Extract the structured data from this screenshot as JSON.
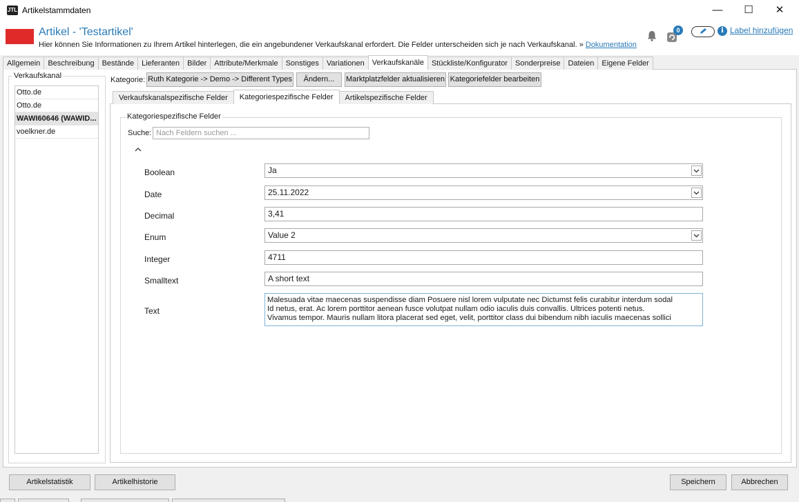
{
  "window": {
    "title": "Artikelstammdaten",
    "logo_text": "JTL",
    "minimize": "—",
    "maximize": "☐",
    "close": "✕"
  },
  "header": {
    "title": "Artikel - 'Testartikel'",
    "description": "Hier können Sie Informationen zu Ihrem Artikel hinterlegen, die ein angebundener Verkaufskanal erfordert. Die Felder unterscheiden sich je nach Verkaufskanal.",
    "arrow": "»",
    "doc_link": "Dokumentation",
    "refresh_badge": "0",
    "info_glyph": "i",
    "label_link": "Label hinzufügen"
  },
  "main_tabs": [
    {
      "label": "Allgemein"
    },
    {
      "label": "Beschreibung"
    },
    {
      "label": "Bestände"
    },
    {
      "label": "Lieferanten"
    },
    {
      "label": "Bilder"
    },
    {
      "label": "Attribute/Merkmale"
    },
    {
      "label": "Sonstiges"
    },
    {
      "label": "Variationen"
    },
    {
      "label": "Verkaufskanäle",
      "active": true
    },
    {
      "label": "Stückliste/Konfigurator"
    },
    {
      "label": "Sonderpreise"
    },
    {
      "label": "Dateien"
    },
    {
      "label": "Eigene Felder"
    }
  ],
  "channels": {
    "title": "Verkaufskanal",
    "items": [
      {
        "label": "Otto.de"
      },
      {
        "label": "Otto.de"
      },
      {
        "label": "WAWI60646 (WAWID...",
        "selected": true
      },
      {
        "label": "voelkner.de"
      }
    ]
  },
  "category": {
    "label": "Kategorie:",
    "path": "Ruth Kategorie -> Demo -> Different Types",
    "change_label": "Ändern...",
    "refresh_fields_label": "Marktplatzfelder aktualisieren",
    "edit_fields_label": "Kategoriefelder bearbeiten"
  },
  "sub_tabs": [
    {
      "label": "Verkaufskanalspezifische Felder"
    },
    {
      "label": "Kategoriespezifische Felder",
      "active": true
    },
    {
      "label": "Artikelspezifische Felder"
    }
  ],
  "fields_group": {
    "title": "Kategoriespezifische Felder",
    "search_label": "Suche:",
    "search_placeholder": "Nach Feldern suchen ..."
  },
  "fields": {
    "boolean": {
      "label": "Boolean",
      "value": "Ja"
    },
    "date": {
      "label": "Date",
      "value": "25.11.2022"
    },
    "decimal": {
      "label": "Decimal",
      "value": "3,41"
    },
    "enum": {
      "label": "Enum",
      "value": "Value 2"
    },
    "integer": {
      "label": "Integer",
      "value": "4711"
    },
    "smalltext": {
      "label": "Smalltext",
      "value": "A short text"
    },
    "text": {
      "label": "Text",
      "lines": [
        "Malesuada vitae maecenas suspendisse diam Posuere nisl lorem vulputate nec Dictumst felis curabitur interdum sodal",
        "Id netus, erat. Ac lorem porttitor aenean fusce volutpat nullam odio iaculis duis convallis. Ultrices potenti netus.",
        "Vivamus tempor. Mauris nullam litora placerat sed eget, velit, porttitor class dui bibendum nibh iaculis maecenas sollici"
      ]
    }
  },
  "footer": {
    "stat_label": "Artikelstatistik",
    "history_label": "Artikelhistorie",
    "save_label": "Speichern",
    "cancel_label": "Abbrechen"
  },
  "colors": {
    "accent": "#2a7ab8",
    "brand_red": "#e02a2a"
  }
}
